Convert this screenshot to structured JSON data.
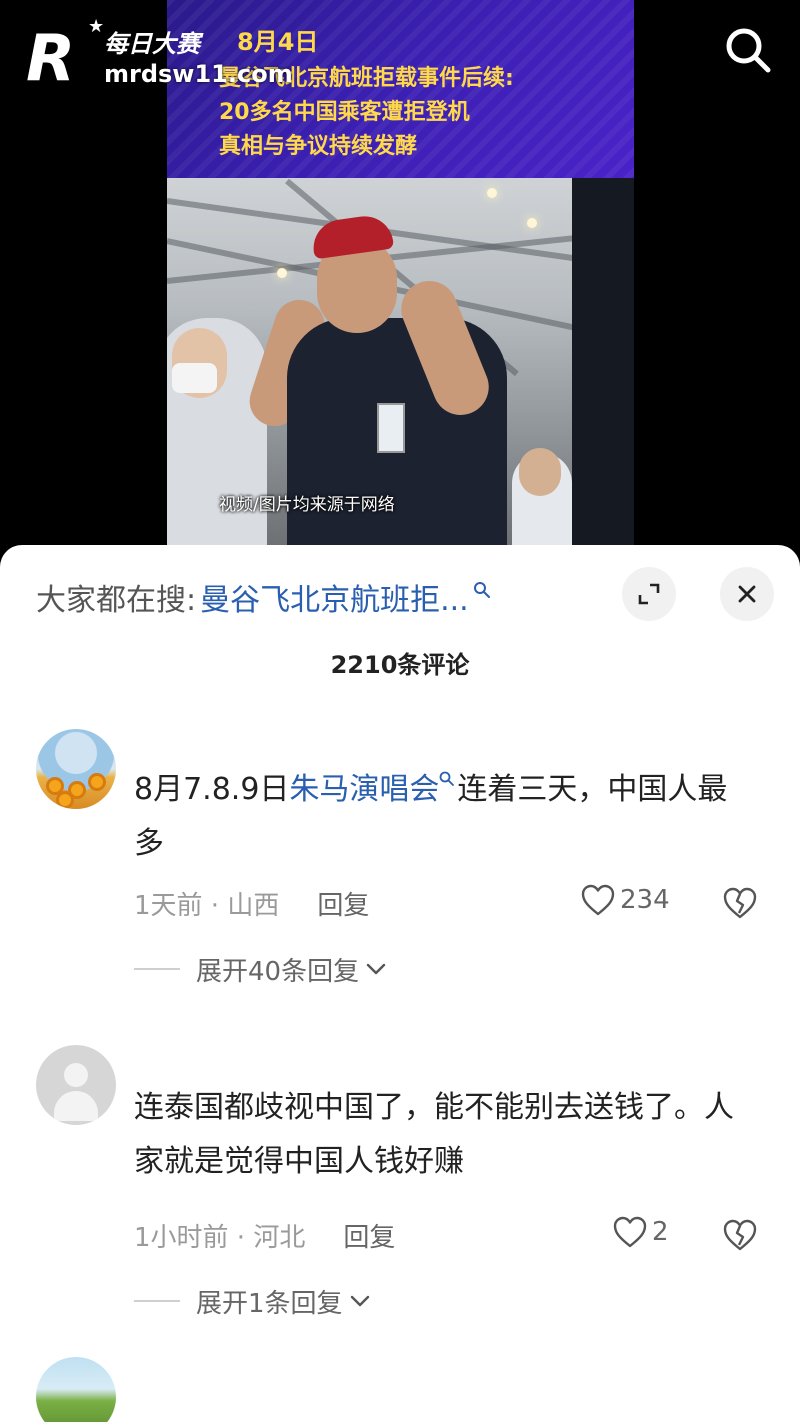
{
  "video": {
    "banner_date": "8月4日",
    "banner_title_line1": "曼谷飞北京航班拒载事件后续:",
    "banner_title_line2": "20多名中国乘客遭拒登机",
    "banner_title_line3": "真相与争议持续发酵",
    "caption": "视频/图片均来源于网络"
  },
  "logo": {
    "name": "每日大赛",
    "url": "mrdsw11.com",
    "letter": "R"
  },
  "panel": {
    "hot_search_prefix": "大家都在搜:",
    "hot_search_query": "曼谷飞北京航班拒...",
    "comment_count": "2210条评论"
  },
  "comments": [
    {
      "text_before": "8月7.8.9日",
      "mention": "朱马演唱会",
      "text_after": "连着三天，中国人最多",
      "time_location": "1天前 · 山西",
      "reply_label": "回复",
      "likes": "234",
      "expand_label": "展开40条回复"
    },
    {
      "text": "连泰国都歧视中国了，能不能别去送钱了。人家就是觉得中国人钱好赚",
      "time_location": "1小时前 · 河北",
      "reply_label": "回复",
      "likes": "2",
      "expand_label": "展开1条回复"
    }
  ],
  "icons": {
    "search": "search-icon",
    "expand": "expand-icon",
    "close": "close-icon",
    "heart": "heart-icon",
    "broken_heart": "broken-heart-icon",
    "chevron": "chevron-down-icon"
  },
  "colors": {
    "link": "#2a5fb0",
    "banner_text": "#ffd94a",
    "banner_bg": "#3a1fb0"
  }
}
